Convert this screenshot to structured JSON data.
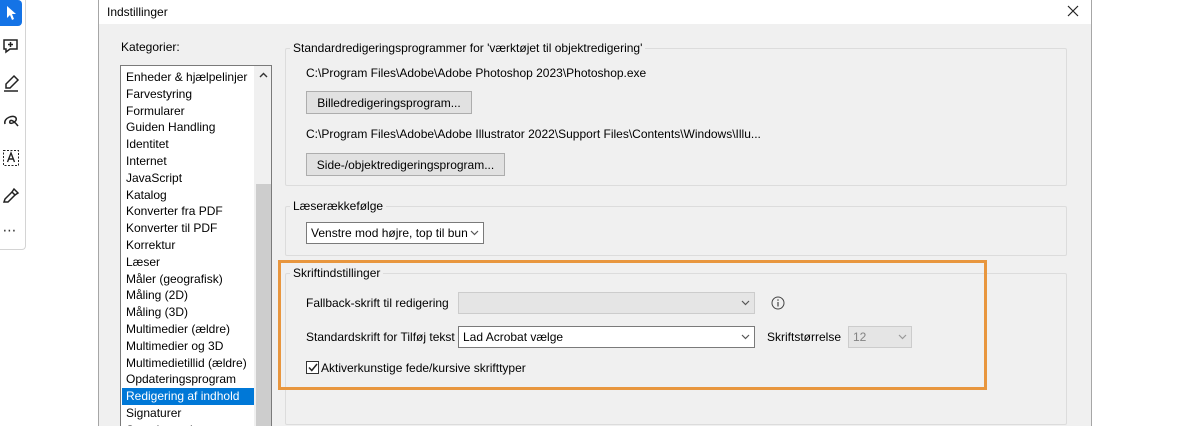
{
  "dialog": {
    "title": "Indstillinger"
  },
  "categories": {
    "label": "Kategorier:",
    "items": [
      "Enheder & hjælpelinjer",
      "Farvestyring",
      "Formularer",
      "Guiden Handling",
      "Identitet",
      "Internet",
      "JavaScript",
      "Katalog",
      "Konverter fra PDF",
      "Konverter til PDF",
      "Korrektur",
      "Læser",
      "Måler (geografisk)",
      "Måling (2D)",
      "Måling (3D)",
      "Multimedier (ældre)",
      "Multimedier og 3D",
      "Multimedietillid (ældre)",
      "Opdateringsprogram",
      "Redigering af indhold",
      "Signaturer",
      "Stavekontrol"
    ],
    "selected": "Redigering af indhold"
  },
  "editors": {
    "title": "Standardredigeringsprogrammer for  'værktøjet til objektredigering'",
    "image_path": "C:\\Program Files\\Adobe\\Adobe Photoshop 2023\\Photoshop.exe",
    "image_button": "Billedredigeringsprogram...",
    "object_path": "C:\\Program Files\\Adobe\\Adobe Illustrator 2022\\Support Files\\Contents\\Windows\\Illu...",
    "object_button": "Side-/objektredigeringsprogram..."
  },
  "reading_order": {
    "title": "Læserækkefølge",
    "value": "Venstre mod højre, top til bunc"
  },
  "font_settings": {
    "title": "Skriftindstillinger",
    "fallback_label": "Fallback-skrift til redigering",
    "fallback_value": "",
    "default_label": "Standardskrift for Tilføj tekst",
    "default_value": "Lad Acrobat vælge",
    "size_label": "Skriftstørrelse",
    "size_value": "12",
    "synthetic_label": "Aktiverkunstige fede/kursive skrifttyper",
    "synthetic_checked": true
  },
  "colors": {
    "highlight": "#e8963e",
    "selection": "#0078d7",
    "tool_selected": "#1473e6"
  }
}
